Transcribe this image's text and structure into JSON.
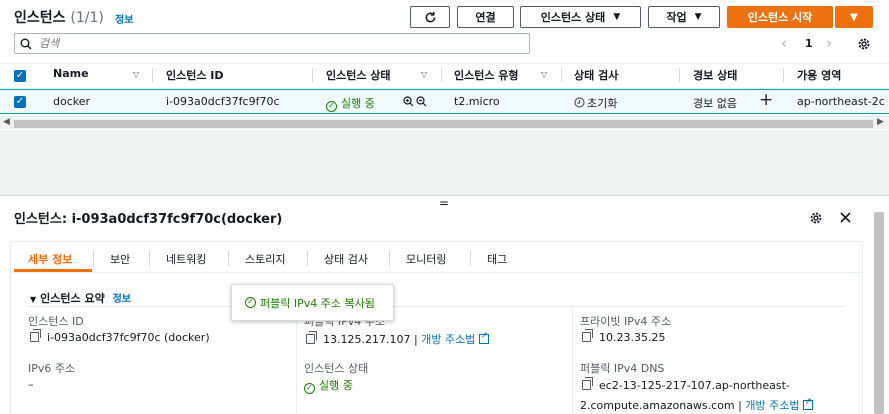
{
  "header": {
    "title": "인스턴스",
    "count": "(1/1)",
    "info": "정보",
    "connect": "연결",
    "instance_state": "인스턴스 상태",
    "actions": "작업",
    "launch": "인스턴스 시작"
  },
  "search": {
    "placeholder": "검색"
  },
  "pagination": {
    "page": "1"
  },
  "table": {
    "headers": [
      "Name",
      "인스턴스 ID",
      "인스턴스 상태",
      "인스턴스 유형",
      "상태 검사",
      "경보 상태",
      "가용 영역"
    ],
    "row": {
      "name": "docker",
      "id": "i-093a0dcf37fc9f70c",
      "state": "실행 중",
      "type": "t2.micro",
      "check": "초기화",
      "alarm": "경보 없음",
      "alarm_add": "+",
      "az": "ap-northeast-2c"
    }
  },
  "details": {
    "drag_handle": "=",
    "title": "인스턴스: i-093a0dcf37fc9f70c(docker)",
    "tabs": [
      "세부 정보",
      "보안",
      "네트워킹",
      "스토리지",
      "상태 검사",
      "모니터링",
      "태그"
    ],
    "summary_title": "인스턴스 요약",
    "summary_info": "정보",
    "toast": "퍼블릭 IPv4 주소 복사됨",
    "instance_id_label": "인스턴스 ID",
    "instance_id_value": "i-093a0dcf37fc9f70c (docker)",
    "public_ip_label": "퍼블릭 IPv4 주소",
    "public_ip_value": "13.125.217.107",
    "open_address": "개방 주소법",
    "private_ip_label": "프라이빗 IPv4 주소",
    "private_ip_value": "10.23.35.25",
    "ipv6_label": "IPv6 주소",
    "ipv6_value": "–",
    "state_label": "인스턴스 상태",
    "state_value": "실행 중",
    "dns_label": "퍼블릭 IPv4 DNS",
    "dns_value_1": "ec2-13-125-217-107.ap-northeast-",
    "dns_value_2": "2.compute.amazonaws.com",
    "dns_open": "개방 주소법",
    "separator": "|"
  },
  "colors": {
    "accent": "#ec7211",
    "link": "#0073bb",
    "success": "#1d8102",
    "selected_row": "#f1faff"
  }
}
